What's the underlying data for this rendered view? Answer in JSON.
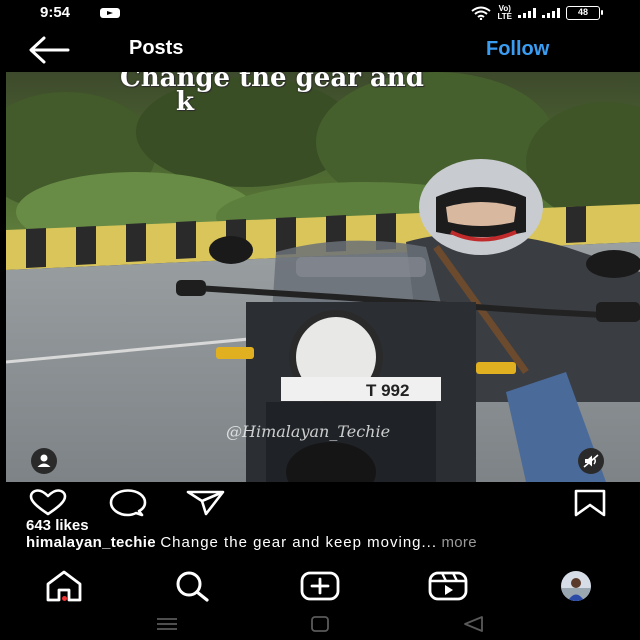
{
  "status_bar": {
    "time": "9:54",
    "volte_top": "Vo)",
    "volte_bottom": "LTE",
    "battery": "48"
  },
  "header": {
    "title": "Posts",
    "follow_label": "Follow",
    "follow_color": "#3a9df2"
  },
  "media": {
    "overlay_text_line1": "Change the gear and",
    "overlay_text_line2": "k",
    "watermark": "@Himalayan_Techie",
    "plate_text": "T 992"
  },
  "post": {
    "likes": "643 likes",
    "username": "himalayan_techie",
    "caption": "Change the gear and keep moving...",
    "more_label": "more"
  },
  "icons": {
    "back": "arrow-left-icon",
    "like": "heart-icon",
    "comment": "comment-icon",
    "share": "send-icon",
    "save": "bookmark-icon",
    "home": "home-icon",
    "search": "search-icon",
    "create": "plus-square-icon",
    "reels": "reels-icon",
    "tag": "person-icon",
    "mute": "speaker-muted-icon"
  }
}
